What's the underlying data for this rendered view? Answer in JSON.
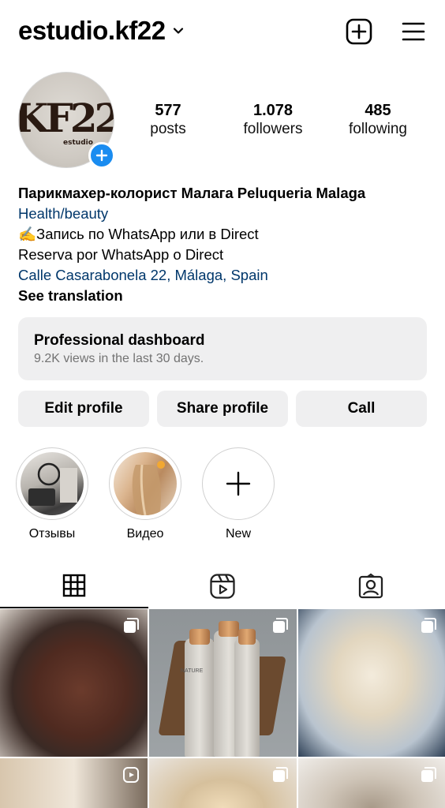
{
  "header": {
    "username": "estudio.kf22"
  },
  "profile": {
    "avatar_text_main": "KF22",
    "avatar_text_sub": "estudio",
    "stats": [
      {
        "value": "577",
        "label": "posts"
      },
      {
        "value": "1.078",
        "label": "followers"
      },
      {
        "value": "485",
        "label": "following"
      }
    ],
    "bio": {
      "name": "Парикмахер-колорист Малага Peluqueria Malaga",
      "category": "Health/beauty",
      "line1": "✍️Запись по WhatsApp или в Direct",
      "line2": "Reserva por WhatsApp o Direct",
      "address": "Calle Casarabonela 22, Málaga, Spain",
      "see_translation": "See translation"
    }
  },
  "dashboard": {
    "title": "Professional dashboard",
    "subtitle": "9.2K views in the last 30 days."
  },
  "actions": {
    "edit": "Edit profile",
    "share": "Share profile",
    "call": "Call"
  },
  "highlights": [
    {
      "label": "Отзывы"
    },
    {
      "label": "Видео"
    },
    {
      "label": "New"
    }
  ],
  "tabs": [
    "grid-icon",
    "reels-icon",
    "tagged-icon"
  ],
  "nature_label": "NATURE",
  "colors": {
    "link": "#00376b",
    "accent_blue": "#1a8cf0",
    "button_bg": "#efeff0",
    "secondary_text": "#737373"
  }
}
